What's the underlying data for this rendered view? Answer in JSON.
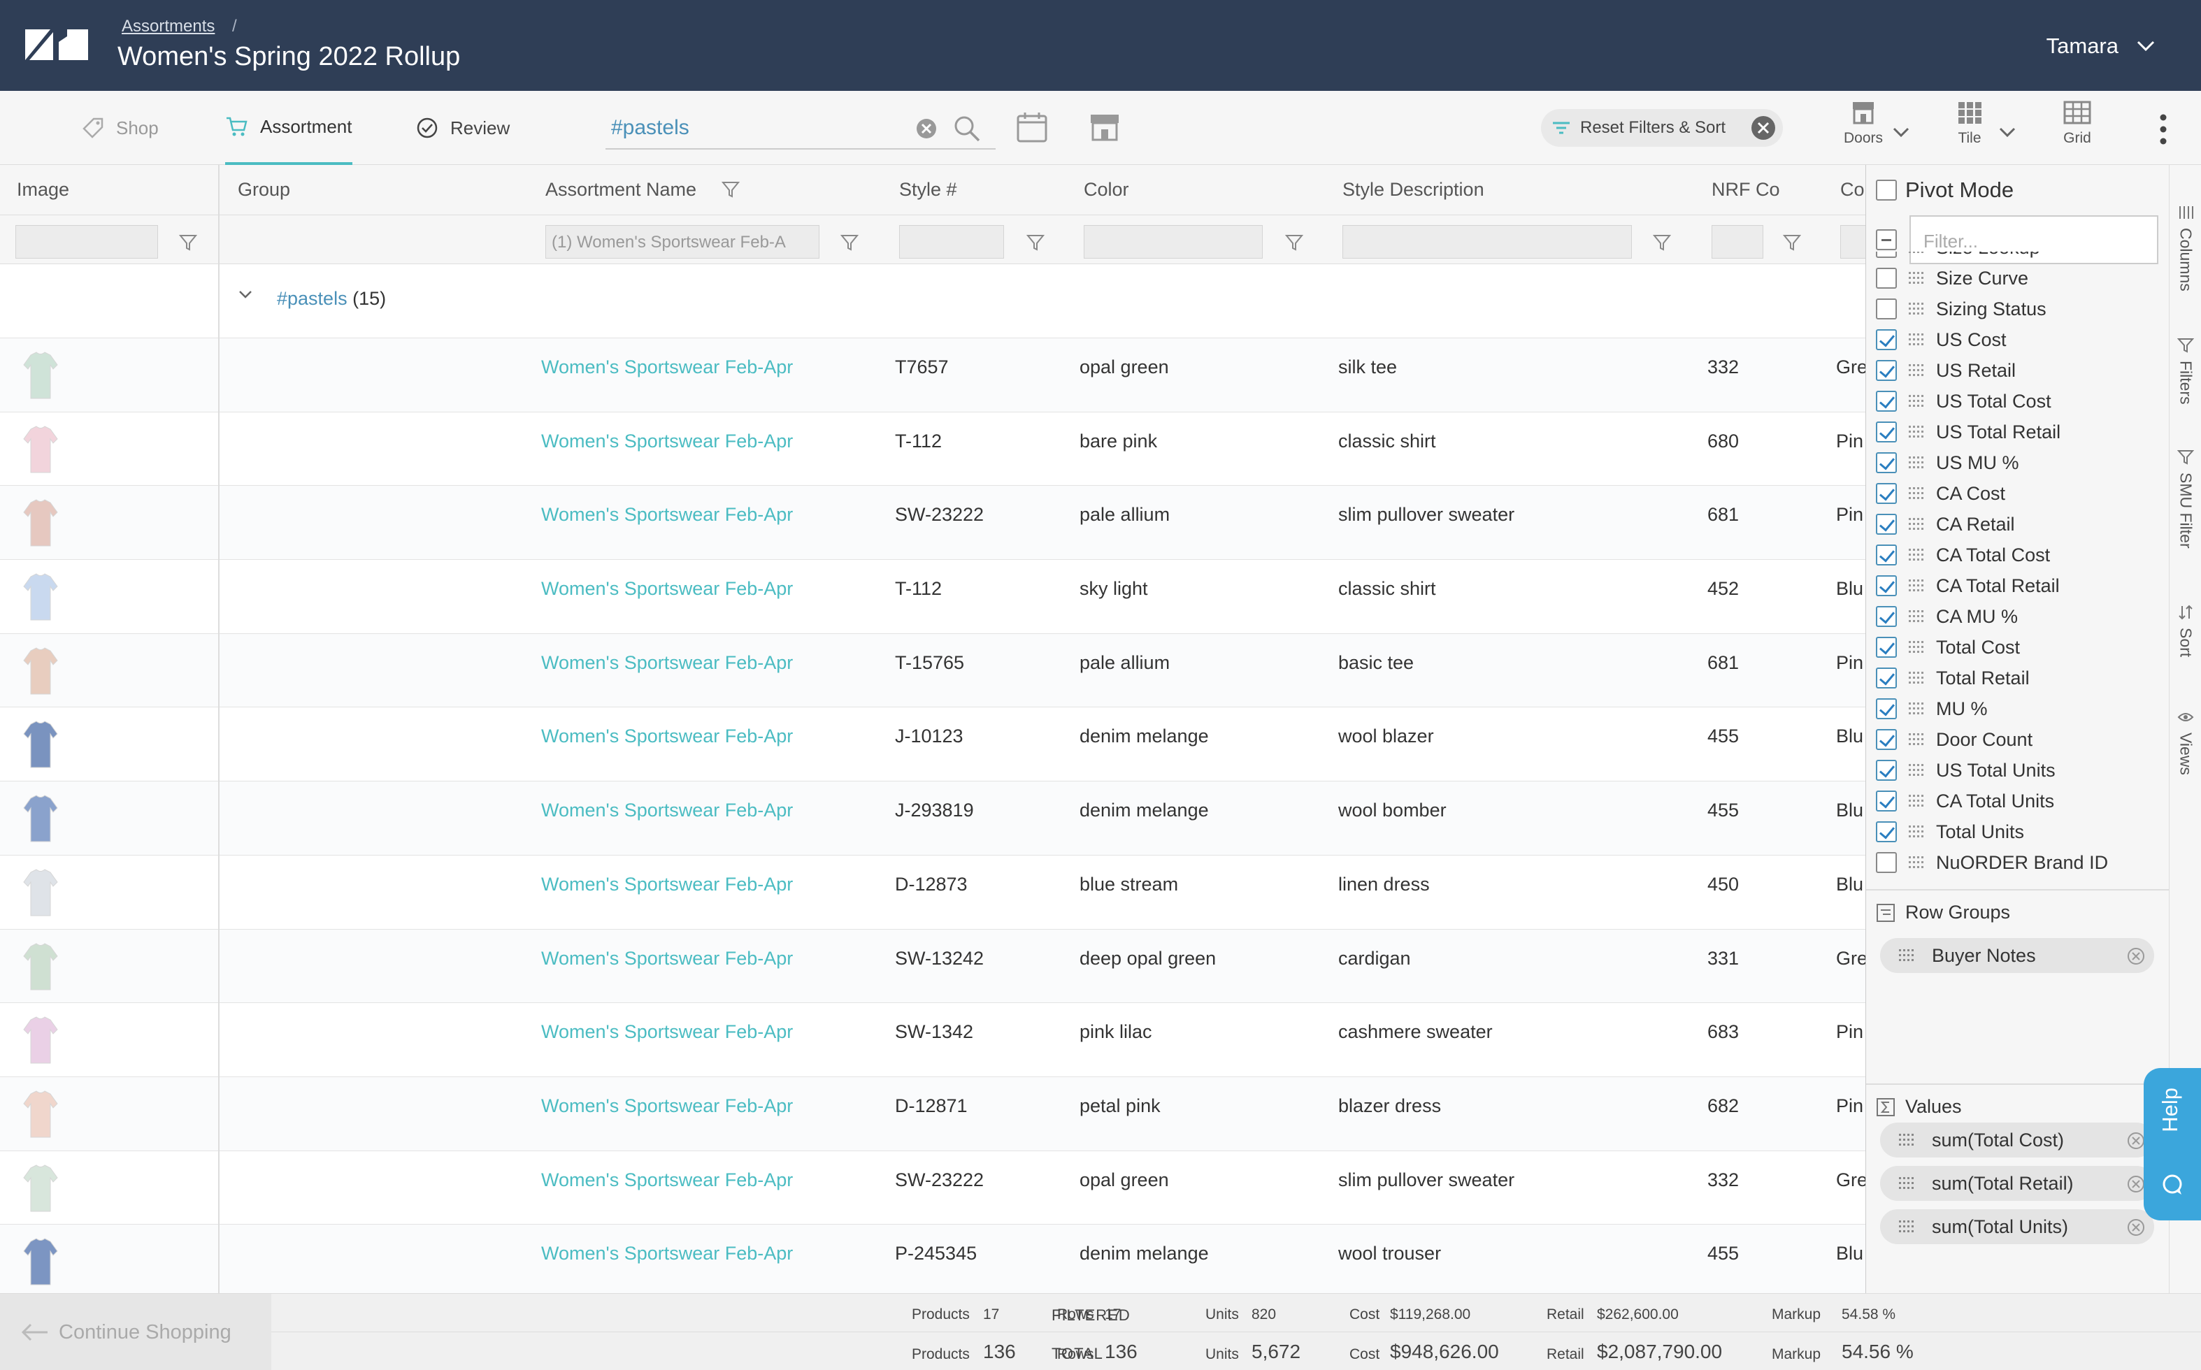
{
  "header": {
    "breadcrumb": "Assortments",
    "breadcrumb_sep": "/",
    "title": "Women's Spring 2022 Rollup",
    "user": "Tamara"
  },
  "toolbar": {
    "tabs": [
      {
        "label": "Shop",
        "icon": "tag-icon"
      },
      {
        "label": "Assortment",
        "icon": "cart-icon"
      },
      {
        "label": "Review",
        "icon": "check-circle-icon"
      }
    ],
    "search_value": "#pastels",
    "reset_label": "Reset Filters & Sort",
    "view_tools": [
      {
        "label": "Doors",
        "icon": "store-icon"
      },
      {
        "label": "Tile",
        "icon": "tile-icon"
      },
      {
        "label": "Grid",
        "icon": "grid-icon"
      }
    ]
  },
  "grid": {
    "columns": [
      "Image",
      "Group",
      "Assortment Name",
      "Style #",
      "Color",
      "Style Description",
      "NRF Co",
      "Co"
    ],
    "assortment_filter_value": "(1) Women's Sportswear Feb-A",
    "group_tag": "#pastels",
    "group_count": "(15)",
    "rows": [
      {
        "name": "Women's Sportswear Feb-Apr",
        "style": "T7657",
        "color": "opal green",
        "desc": "silk tee",
        "nrf": "332",
        "co": "Gre",
        "swatch": "#cfe3d8"
      },
      {
        "name": "Women's Sportswear Feb-Apr",
        "style": "T-112",
        "color": "bare pink",
        "desc": "classic shirt",
        "nrf": "680",
        "co": "Pin",
        "swatch": "#f2d4dc"
      },
      {
        "name": "Women's Sportswear Feb-Apr",
        "style": "SW-23222",
        "color": "pale allium",
        "desc": "slim pullover sweater",
        "nrf": "681",
        "co": "Pin",
        "swatch": "#e6c8c0"
      },
      {
        "name": "Women's Sportswear Feb-Apr",
        "style": "T-112",
        "color": "sky light",
        "desc": "classic shirt",
        "nrf": "452",
        "co": "Blu",
        "swatch": "#c9d9ef"
      },
      {
        "name": "Women's Sportswear Feb-Apr",
        "style": "T-15765",
        "color": "pale allium",
        "desc": "basic tee",
        "nrf": "681",
        "co": "Pin",
        "swatch": "#e8cdbf"
      },
      {
        "name": "Women's Sportswear Feb-Apr",
        "style": "J-10123",
        "color": "denim melange",
        "desc": "wool blazer",
        "nrf": "455",
        "co": "Blu",
        "swatch": "#7a93bf"
      },
      {
        "name": "Women's Sportswear Feb-Apr",
        "style": "J-293819",
        "color": "denim melange",
        "desc": "wool bomber",
        "nrf": "455",
        "co": "Blu",
        "swatch": "#8aa2cc"
      },
      {
        "name": "Women's Sportswear Feb-Apr",
        "style": "D-12873",
        "color": "blue stream",
        "desc": "linen dress",
        "nrf": "450",
        "co": "Blu",
        "swatch": "#dfe3e8"
      },
      {
        "name": "Women's Sportswear Feb-Apr",
        "style": "SW-13242",
        "color": "deep opal green",
        "desc": "cardigan",
        "nrf": "331",
        "co": "Gre",
        "swatch": "#cfe0d2"
      },
      {
        "name": "Women's Sportswear Feb-Apr",
        "style": "SW-1342",
        "color": "pink lilac",
        "desc": "cashmere sweater",
        "nrf": "683",
        "co": "Pin",
        "swatch": "#ead0e6"
      },
      {
        "name": "Women's Sportswear Feb-Apr",
        "style": "D-12871",
        "color": "petal pink",
        "desc": "blazer dress",
        "nrf": "682",
        "co": "Pin",
        "swatch": "#f0d6cc"
      },
      {
        "name": "Women's Sportswear Feb-Apr",
        "style": "SW-23222",
        "color": "opal green",
        "desc": "slim pullover sweater",
        "nrf": "332",
        "co": "Gre",
        "swatch": "#d8e6dc"
      },
      {
        "name": "Women's Sportswear Feb-Apr",
        "style": "P-245345",
        "color": "denim melange",
        "desc": "wool trouser",
        "nrf": "455",
        "co": "Blu",
        "swatch": "#7c95c2"
      }
    ]
  },
  "panel": {
    "pivot_mode": "Pivot Mode",
    "filter_placeholder": "Filter...",
    "columns": [
      {
        "label": "Size Lookup",
        "checked": false
      },
      {
        "label": "Size Curve",
        "checked": false
      },
      {
        "label": "Sizing Status",
        "checked": false
      },
      {
        "label": "US Cost",
        "checked": true
      },
      {
        "label": "US Retail",
        "checked": true
      },
      {
        "label": "US Total Cost",
        "checked": true
      },
      {
        "label": "US Total Retail",
        "checked": true
      },
      {
        "label": "US MU %",
        "checked": true
      },
      {
        "label": "CA Cost",
        "checked": true
      },
      {
        "label": "CA Retail",
        "checked": true
      },
      {
        "label": "CA Total Cost",
        "checked": true
      },
      {
        "label": "CA Total Retail",
        "checked": true
      },
      {
        "label": "CA MU %",
        "checked": true
      },
      {
        "label": "Total Cost",
        "checked": true
      },
      {
        "label": "Total Retail",
        "checked": true
      },
      {
        "label": "MU %",
        "checked": true
      },
      {
        "label": "Door Count",
        "checked": true
      },
      {
        "label": "US Total Units",
        "checked": true
      },
      {
        "label": "CA Total Units",
        "checked": true
      },
      {
        "label": "Total Units",
        "checked": true
      },
      {
        "label": "NuORDER Brand ID",
        "checked": false
      }
    ],
    "row_groups_label": "Row Groups",
    "row_groups": [
      "Buyer Notes"
    ],
    "values_label": "Values",
    "values": [
      "sum(Total Cost)",
      "sum(Total Retail)",
      "sum(Total Units)"
    ],
    "side_tabs": [
      "Columns",
      "Filters",
      "SMU Filter",
      "Sort",
      "Views"
    ],
    "help_label": "Help"
  },
  "footer": {
    "continue_label": "Continue Shopping",
    "filtered": {
      "tag": "FILTERED",
      "products_k": "Products",
      "products_v": "17",
      "rows_k": "Rows",
      "rows_v": "17",
      "units_k": "Units",
      "units_v": "820",
      "cost_k": "Cost",
      "cost_v": "$119,268.00",
      "retail_k": "Retail",
      "retail_v": "$262,600.00",
      "markup_k": "Markup",
      "markup_v": "54.58 %"
    },
    "total": {
      "tag": "TOTAL",
      "products_k": "Products",
      "products_v": "136",
      "rows_k": "Rows",
      "rows_v": "136",
      "units_k": "Units",
      "units_v": "5,672",
      "cost_k": "Cost",
      "cost_v": "$948,626.00",
      "retail_k": "Retail",
      "retail_v": "$2,087,790.00",
      "markup_k": "Markup",
      "markup_v": "54.56 %"
    }
  }
}
